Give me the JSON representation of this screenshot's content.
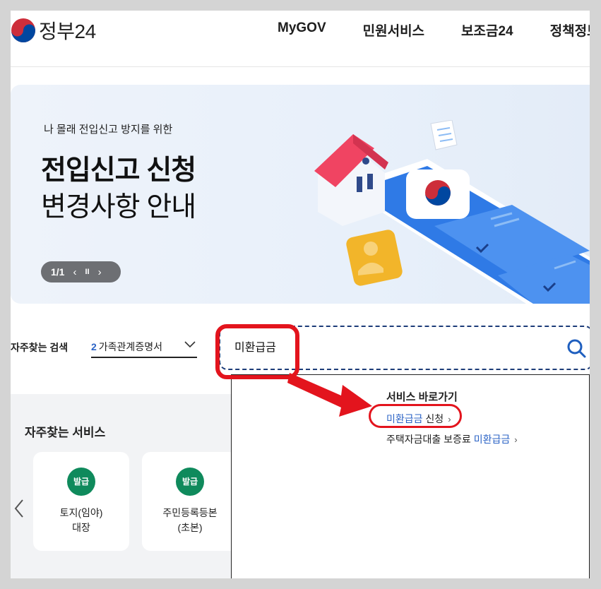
{
  "header": {
    "logo_text": "정부24",
    "nav": [
      "MyGOV",
      "민원서비스",
      "보조금24",
      "정책정보"
    ]
  },
  "banner": {
    "eyebrow": "나 몰래 전입신고 방지를 위한",
    "title_line1": "전입신고 신청",
    "title_line2": "변경사항 안내",
    "pager_count": "1/1",
    "prev_label": "‹",
    "pause_label": "II",
    "next_label": "›"
  },
  "search": {
    "fav_label": "자주찾는 검색",
    "fav_num": "2",
    "fav_value": "가족관계증명서",
    "query": "미환급금"
  },
  "dropdown": {
    "heading": "서비스 바로가기",
    "item1_highlight": "미환급금",
    "item1_rest": " 신청",
    "item2_prefix": "주택자금대출 보증료 ",
    "item2_highlight": "미환급금",
    "arrow": "›"
  },
  "services": {
    "title": "자주찾는 서비스",
    "cards": [
      {
        "badge": "발급",
        "line1": "토지(임야)",
        "line2": "대장"
      },
      {
        "badge": "발급",
        "line1": "주민등록등본",
        "line2": "(초본)"
      }
    ]
  },
  "colors": {
    "accent_blue": "#2b63c6",
    "badge_green": "#0f8a5c",
    "annotation_red": "#e3141d"
  },
  "icons": [
    "taegeuk-logo-icon",
    "search-icon",
    "chevron-down-icon",
    "chevron-left-icon",
    "house-illustration",
    "phone-illustration"
  ]
}
